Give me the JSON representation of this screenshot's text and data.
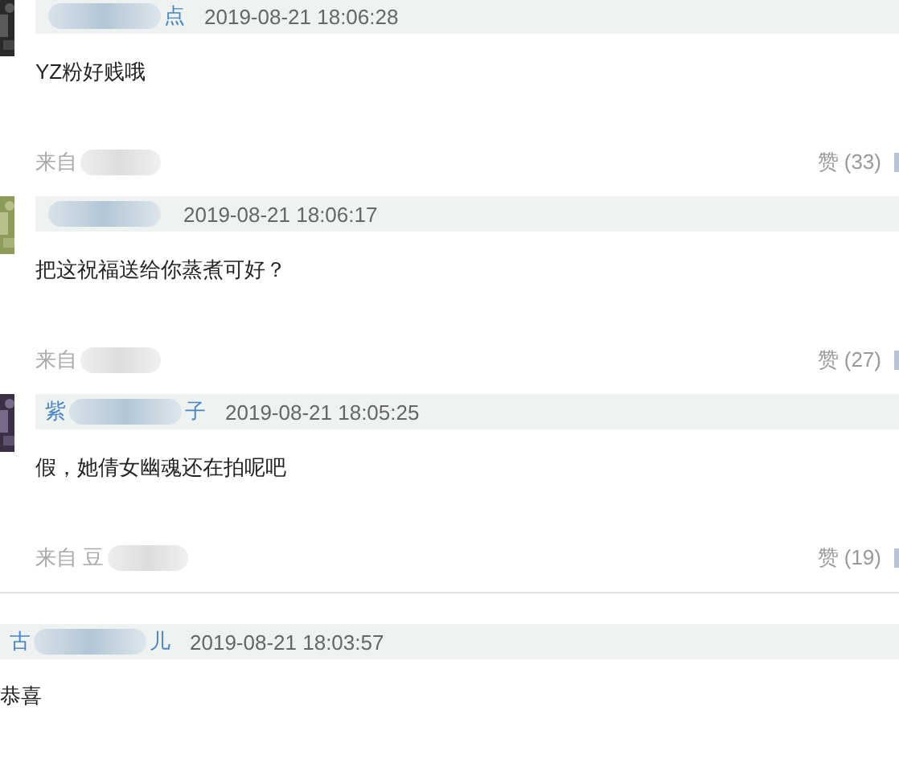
{
  "comments": [
    {
      "indented": true,
      "name_end": "点",
      "time": "2019-08-21 18:06:28",
      "text": "YZ粉好贱哦",
      "source": "来自",
      "likes": "赞 (33)"
    },
    {
      "indented": true,
      "time": "2019-08-21 18:06:17",
      "text": "把这祝福送给你蒸煮可好？",
      "source": "来自",
      "likes": "赞 (27)"
    },
    {
      "indented": true,
      "name_start": "紫",
      "name_end": "子",
      "time": "2019-08-21 18:05:25",
      "text": "假，她倩女幽魂还在拍呢吧",
      "source": "来自 豆",
      "likes": "赞 (19)"
    },
    {
      "indented": false,
      "name_start": "古",
      "name_end": "儿",
      "time": "2019-08-21 18:03:57",
      "text": "恭喜"
    }
  ]
}
